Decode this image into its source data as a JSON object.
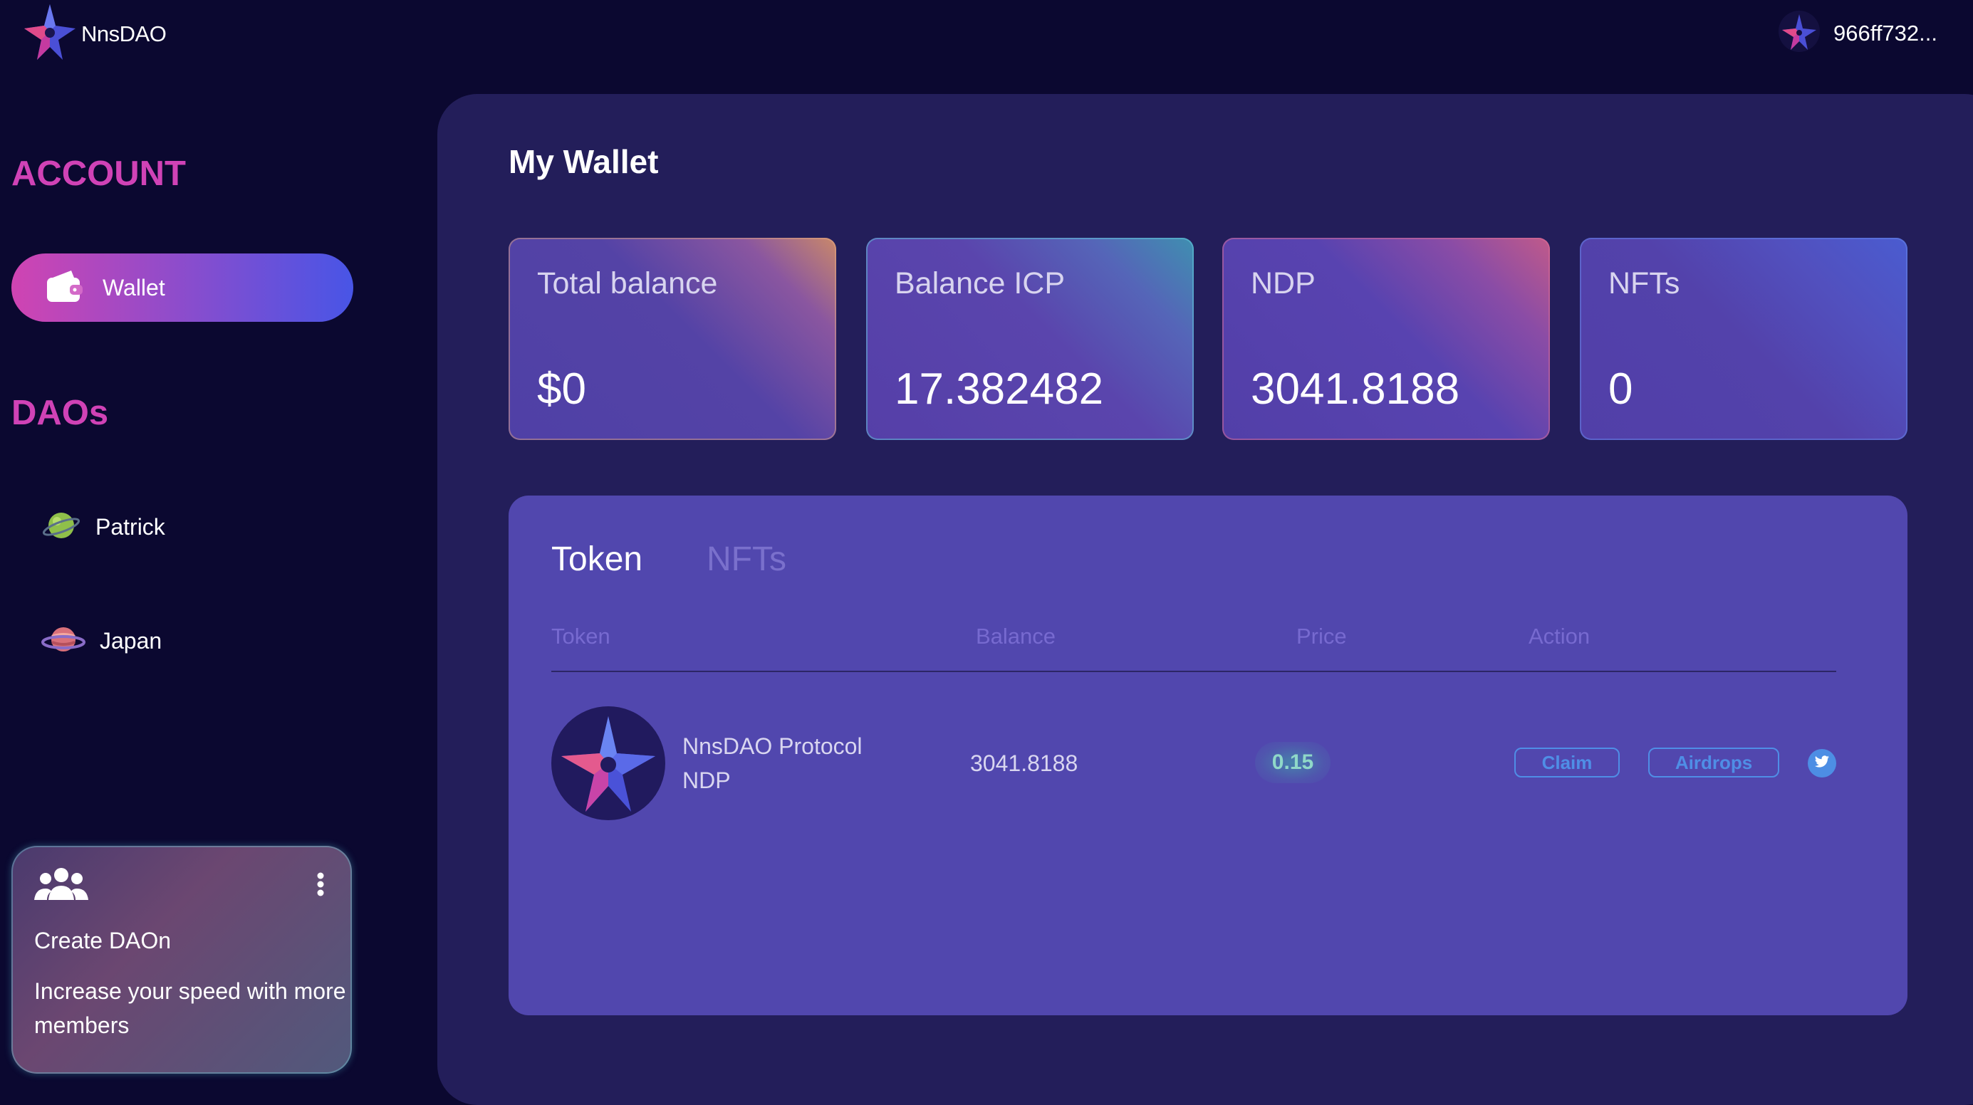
{
  "header": {
    "logo_text": "NnsDAO",
    "account_id": "966ff732..."
  },
  "sidebar": {
    "account_title": "ACCOUNT",
    "wallet_label": "Wallet",
    "daos_title": "DAOs",
    "daos": [
      {
        "name": "Patrick",
        "icon": "green-planet-icon"
      },
      {
        "name": "Japan",
        "icon": "pink-planet-icon"
      }
    ],
    "create_card": {
      "title": "Create DAOn",
      "description": "Increase your speed with more members"
    }
  },
  "main": {
    "title": "My Wallet",
    "stats": [
      {
        "label": "Total balance",
        "value": "$0"
      },
      {
        "label": "Balance ICP",
        "value": "17.382482"
      },
      {
        "label": "NDP",
        "value": "3041.8188"
      },
      {
        "label": "NFTs",
        "value": "0"
      }
    ],
    "tabs": [
      "Token",
      "NFTs"
    ],
    "active_tab": "Token",
    "columns": [
      "Token",
      "Balance",
      "Price",
      "Action"
    ],
    "rows": [
      {
        "token_name": "NnsDAO Protocol",
        "token_symbol": "NDP",
        "balance": "3041.8188",
        "price": "0.15",
        "actions": [
          "Claim",
          "Airdrops"
        ]
      }
    ]
  },
  "colors": {
    "accent_pink": "#d042b6",
    "accent_blue": "#4855e6",
    "link_blue": "#4f8ee6",
    "panel": "#5147ae"
  }
}
